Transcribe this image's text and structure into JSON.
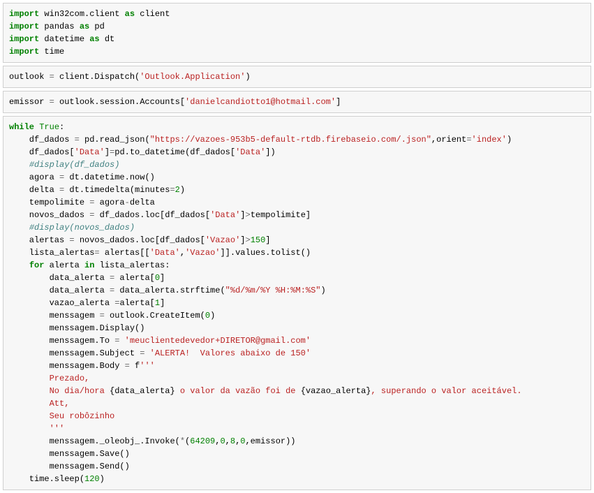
{
  "cells": [
    {
      "lines": [
        [
          {
            "t": "import",
            "cls": "k"
          },
          {
            "t": " win32com.client "
          },
          {
            "t": "as",
            "cls": "k"
          },
          {
            "t": " client"
          }
        ],
        [
          {
            "t": "import",
            "cls": "k"
          },
          {
            "t": " pandas "
          },
          {
            "t": "as",
            "cls": "k"
          },
          {
            "t": " pd"
          }
        ],
        [
          {
            "t": "import",
            "cls": "k"
          },
          {
            "t": " datetime "
          },
          {
            "t": "as",
            "cls": "k"
          },
          {
            "t": " dt"
          }
        ],
        [
          {
            "t": "import",
            "cls": "k"
          },
          {
            "t": " time"
          }
        ]
      ]
    },
    {
      "lines": [
        [
          {
            "t": "outlook "
          },
          {
            "t": "=",
            "cls": "o"
          },
          {
            "t": " client.Dispatch("
          },
          {
            "t": "'Outlook.Application'",
            "cls": "s"
          },
          {
            "t": ")"
          }
        ]
      ]
    },
    {
      "lines": [
        [
          {
            "t": "emissor "
          },
          {
            "t": "=",
            "cls": "o"
          },
          {
            "t": " outlook.session.Accounts["
          },
          {
            "t": "'danielcandiotto1@hotmail.com'",
            "cls": "s"
          },
          {
            "t": "]"
          }
        ]
      ]
    },
    {
      "lines": [
        [
          {
            "t": "while",
            "cls": "k"
          },
          {
            "t": " "
          },
          {
            "t": "True",
            "cls": "b"
          },
          {
            "t": ":"
          }
        ],
        [
          {
            "t": "    df_dados "
          },
          {
            "t": "=",
            "cls": "o"
          },
          {
            "t": " pd.read_json("
          },
          {
            "t": "\"https://vazoes-953b5-default-rtdb.firebaseio.com/.json\"",
            "cls": "s"
          },
          {
            "t": ",orient"
          },
          {
            "t": "=",
            "cls": "o"
          },
          {
            "t": "'index'",
            "cls": "s"
          },
          {
            "t": ")"
          }
        ],
        [
          {
            "t": "    df_dados["
          },
          {
            "t": "'Data'",
            "cls": "s"
          },
          {
            "t": "]"
          },
          {
            "t": "=",
            "cls": "o"
          },
          {
            "t": "pd.to_datetime(df_dados["
          },
          {
            "t": "'Data'",
            "cls": "s"
          },
          {
            "t": "])"
          }
        ],
        [
          {
            "t": "    "
          },
          {
            "t": "#display(df_dados)",
            "cls": "c"
          }
        ],
        [
          {
            "t": "    agora "
          },
          {
            "t": "=",
            "cls": "o"
          },
          {
            "t": " dt.datetime.now()"
          }
        ],
        [
          {
            "t": "    delta "
          },
          {
            "t": "=",
            "cls": "o"
          },
          {
            "t": " dt.timedelta(minutes"
          },
          {
            "t": "=",
            "cls": "o"
          },
          {
            "t": "2",
            "cls": "m"
          },
          {
            "t": ")"
          }
        ],
        [
          {
            "t": "    tempolimite "
          },
          {
            "t": "=",
            "cls": "o"
          },
          {
            "t": " agora"
          },
          {
            "t": "-",
            "cls": "o"
          },
          {
            "t": "delta"
          }
        ],
        [
          {
            "t": "    novos_dados "
          },
          {
            "t": "=",
            "cls": "o"
          },
          {
            "t": " df_dados.loc[df_dados["
          },
          {
            "t": "'Data'",
            "cls": "s"
          },
          {
            "t": "]"
          },
          {
            "t": ">",
            "cls": "o"
          },
          {
            "t": "tempolimite]"
          }
        ],
        [
          {
            "t": "    "
          },
          {
            "t": "#display(novos_dados)",
            "cls": "c"
          }
        ],
        [
          {
            "t": "    alertas "
          },
          {
            "t": "=",
            "cls": "o"
          },
          {
            "t": " novos_dados.loc[df_dados["
          },
          {
            "t": "'Vazao'",
            "cls": "s"
          },
          {
            "t": "]"
          },
          {
            "t": ">",
            "cls": "o"
          },
          {
            "t": "150",
            "cls": "m"
          },
          {
            "t": "]"
          }
        ],
        [
          {
            "t": "    lista_alertas"
          },
          {
            "t": "=",
            "cls": "o"
          },
          {
            "t": " alertas[["
          },
          {
            "t": "'Data'",
            "cls": "s"
          },
          {
            "t": ","
          },
          {
            "t": "'Vazao'",
            "cls": "s"
          },
          {
            "t": "]].values.tolist()"
          }
        ],
        [
          {
            "t": "    "
          },
          {
            "t": "for",
            "cls": "k"
          },
          {
            "t": " alerta "
          },
          {
            "t": "in",
            "cls": "k"
          },
          {
            "t": " lista_alertas:"
          }
        ],
        [
          {
            "t": "        data_alerta "
          },
          {
            "t": "=",
            "cls": "o"
          },
          {
            "t": " alerta["
          },
          {
            "t": "0",
            "cls": "m"
          },
          {
            "t": "]"
          }
        ],
        [
          {
            "t": "        data_alerta "
          },
          {
            "t": "=",
            "cls": "o"
          },
          {
            "t": " data_alerta.strftime("
          },
          {
            "t": "\"%d/%m/%Y %H:%M:%S\"",
            "cls": "s"
          },
          {
            "t": ")"
          }
        ],
        [
          {
            "t": "        vazao_alerta "
          },
          {
            "t": "=",
            "cls": "o"
          },
          {
            "t": "alerta["
          },
          {
            "t": "1",
            "cls": "m"
          },
          {
            "t": "]"
          }
        ],
        [
          {
            "t": "        menssagem "
          },
          {
            "t": "=",
            "cls": "o"
          },
          {
            "t": " outlook.CreateItem("
          },
          {
            "t": "0",
            "cls": "m"
          },
          {
            "t": ")"
          }
        ],
        [
          {
            "t": "        menssagem.Display()"
          }
        ],
        [
          {
            "t": "        menssagem.To "
          },
          {
            "t": "=",
            "cls": "o"
          },
          {
            "t": " "
          },
          {
            "t": "'meuclientedevedor+DIRETOR@gmail.com'",
            "cls": "s"
          }
        ],
        [
          {
            "t": "        menssagem.Subject "
          },
          {
            "t": "=",
            "cls": "o"
          },
          {
            "t": " "
          },
          {
            "t": "'ALERTA!  Valores abaixo de 150'",
            "cls": "s"
          }
        ],
        [
          {
            "t": "        menssagem.Body "
          },
          {
            "t": "=",
            "cls": "o"
          },
          {
            "t": " f"
          },
          {
            "t": "'''",
            "cls": "s"
          }
        ],
        [
          {
            "t": "        Prezado,",
            "cls": "s"
          }
        ],
        [
          {
            "t": "        No dia/hora ",
            "cls": "s"
          },
          {
            "t": "{data_alerta}"
          },
          {
            "t": " o valor da vazão foi de ",
            "cls": "s"
          },
          {
            "t": "{vazao_alerta}"
          },
          {
            "t": ", superando o valor aceitável.",
            "cls": "s"
          }
        ],
        [
          {
            "t": "        Att,",
            "cls": "s"
          }
        ],
        [
          {
            "t": "        Seu robôzinho",
            "cls": "s"
          }
        ],
        [
          {
            "t": "        '''",
            "cls": "s"
          }
        ],
        [
          {
            "t": "        menssagem._oleobj_.Invoke("
          },
          {
            "t": "*",
            "cls": "o"
          },
          {
            "t": "("
          },
          {
            "t": "64209",
            "cls": "m"
          },
          {
            "t": ","
          },
          {
            "t": "0",
            "cls": "m"
          },
          {
            "t": ","
          },
          {
            "t": "8",
            "cls": "m"
          },
          {
            "t": ","
          },
          {
            "t": "0",
            "cls": "m"
          },
          {
            "t": ",emissor))"
          }
        ],
        [
          {
            "t": "        menssagem.Save()"
          }
        ],
        [
          {
            "t": "        menssagem.Send()"
          }
        ],
        [
          {
            "t": "    time.sleep("
          },
          {
            "t": "120",
            "cls": "m"
          },
          {
            "t": ")"
          }
        ]
      ]
    }
  ]
}
